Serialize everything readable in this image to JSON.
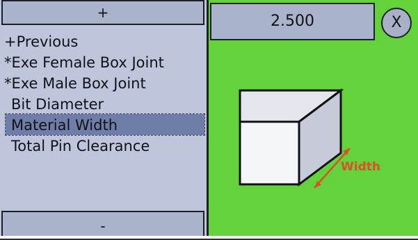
{
  "controls": {
    "scroll_up": "+",
    "scroll_down": "-"
  },
  "menu": {
    "items": [
      {
        "label": "+Previous",
        "selected": false
      },
      {
        "label": "*Exe Female Box Joint",
        "selected": false
      },
      {
        "label": "*Exe Male Box Joint",
        "selected": false
      },
      {
        "label": "Bit Diameter",
        "selected": false
      },
      {
        "label": "Material Width",
        "selected": true
      },
      {
        "label": "Total Pin Clearance",
        "selected": false
      }
    ]
  },
  "value_display": {
    "value": "2.500"
  },
  "close_button": {
    "label": "X"
  },
  "diagram": {
    "dimension_label": "Width"
  },
  "colors": {
    "right_panel_bg": "#64d23a",
    "menu_bg": "#bfc6dc",
    "selection": "#6f7ea8",
    "dimension": "#d9512a"
  },
  "icons": {
    "close": "close-icon",
    "box": "box-diagram-icon",
    "arrow": "double-arrow-icon"
  }
}
